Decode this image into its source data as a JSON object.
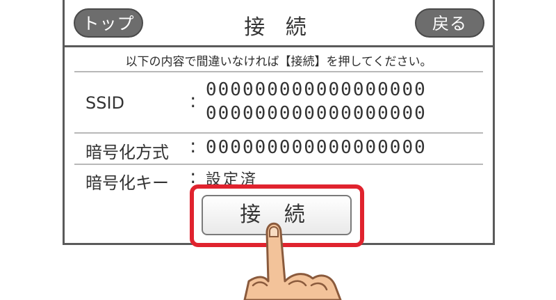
{
  "header": {
    "top_label": "トップ",
    "title": "接 続",
    "back_label": "戻る"
  },
  "instruction": "以下の内容で間違いなければ【接続】を押してください。",
  "fields": {
    "ssid": {
      "label": "SSID",
      "value_line1": "000000000000000000",
      "value_line2": "000000000000000000"
    },
    "encryption": {
      "label": "暗号化方式",
      "value": "000000000000000000"
    },
    "key": {
      "label": "暗号化キー",
      "value": "設定済"
    }
  },
  "colon": ":",
  "connect_label": "接 続",
  "colors": {
    "pill": "#6d6d6d",
    "highlight": "#e0232e",
    "skin": "#f3c39a",
    "skin_outline": "#8a5a3c"
  },
  "icons": {
    "hand": "pointing-hand-icon"
  }
}
